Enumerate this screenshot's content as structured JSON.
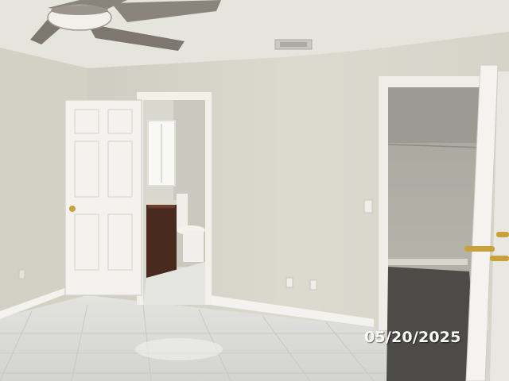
{
  "photo": {
    "date_stamp": "05/20/2025",
    "palette": {
      "wall": "#d9d7cb",
      "ceiling": "#e4e3dc",
      "floor_tile": "#dcdcda",
      "door": "#f3f2ee",
      "vanity": "#4a2a1e",
      "hardware": "#c9a13b"
    }
  }
}
